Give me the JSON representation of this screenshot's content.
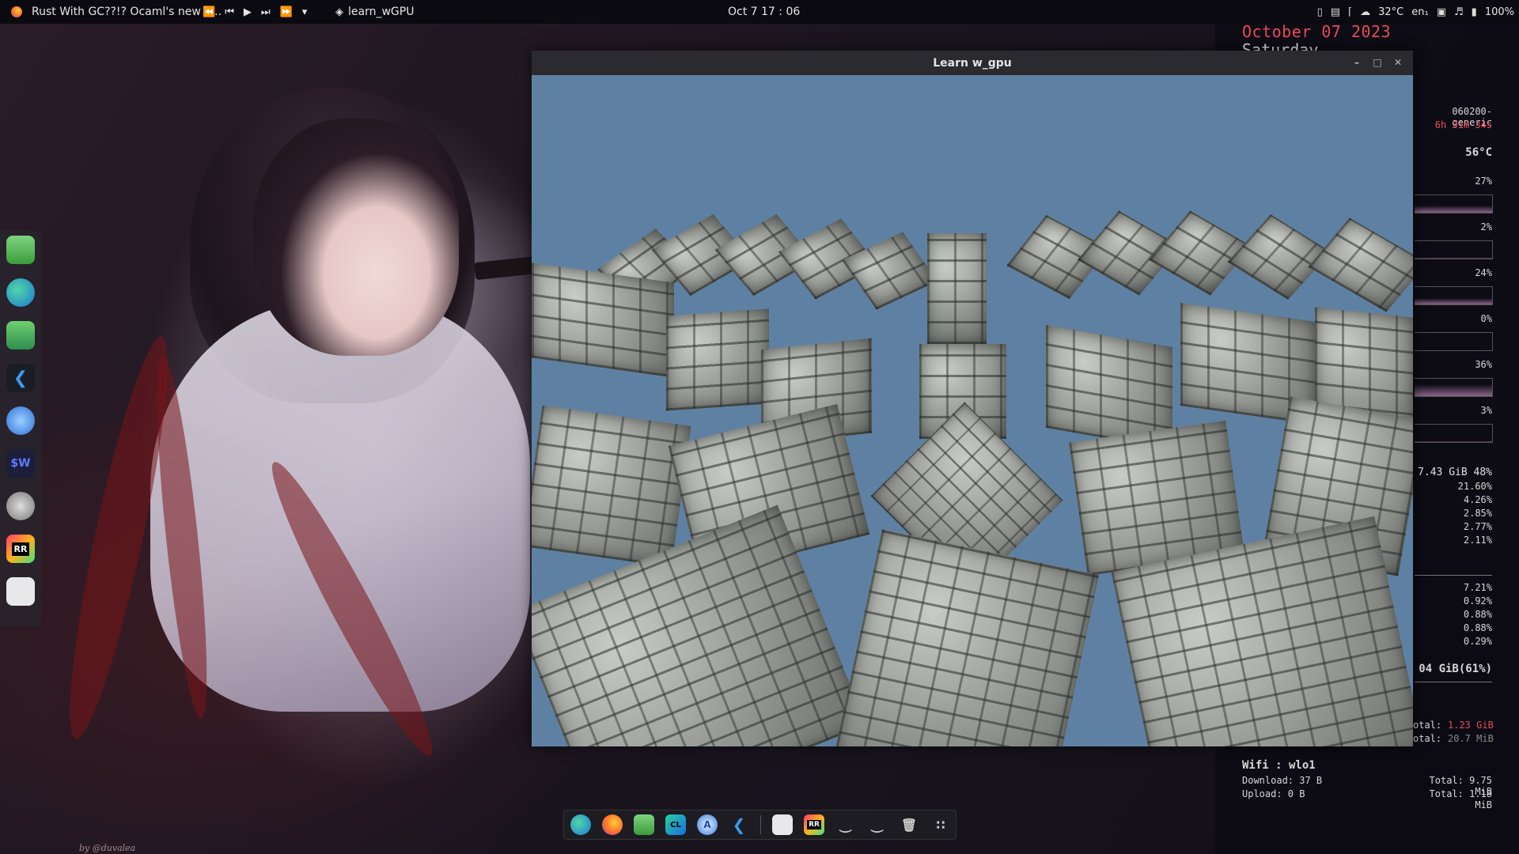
{
  "topbar": {
    "media_title": "Rust With GC??!? Ocaml's new F…",
    "media_controls": [
      "⏪",
      "⏮",
      "▶",
      "⏭",
      "⏩",
      "▾"
    ],
    "active_app": "learn_wGPU",
    "clock": "Oct 7  17 : 06",
    "weather": "32°C",
    "keyboard_layout": "en₁",
    "battery": "100%"
  },
  "window": {
    "title": "Learn w_gpu",
    "minimize": "–",
    "maximize": "□",
    "close": "✕"
  },
  "conky": {
    "date": "October 07 2023",
    "day": "Saturday",
    "kernel": "060200-generic",
    "uptime": "6h 31m 34s",
    "temp": "56°C",
    "cpu_percents": [
      "27%",
      "2%",
      "24%",
      "0%",
      "36%",
      "3%"
    ],
    "ram": "7.43 GiB 48%",
    "top_mem": [
      "21.60%",
      "4.26%",
      "2.85%",
      "2.77%",
      "2.11%"
    ],
    "top_cpu": [
      "7.21%",
      "0.92%",
      "0.88%",
      "0.88%",
      "0.29%"
    ],
    "disk": "04 GiB(61%)",
    "disk_total_read_label": "otal:",
    "disk_total_read": "1.23 GiB",
    "disk_total_write_label": "otal:",
    "disk_total_write": "20.7 MiB",
    "wifi_title": "Wifi : wlo1",
    "download": "Download:  37 B",
    "upload": "Upload:  0 B",
    "total_down": "Total: 9.75 MiB",
    "total_up": "Total: 1.18 MiB",
    "accent": "#e94b5a"
  },
  "left_dock": {
    "items": [
      {
        "icon": "files-icon",
        "label": ""
      },
      {
        "icon": "edge-icon",
        "label": ""
      },
      {
        "icon": "terminal-icon",
        "label": ""
      },
      {
        "icon": "vscode-icon",
        "label": ""
      },
      {
        "icon": "safari-icon",
        "label": ""
      },
      {
        "icon": "warp-icon",
        "label": "$W"
      },
      {
        "icon": "mouse-icon",
        "label": ""
      },
      {
        "icon": "rustrover-icon",
        "label": "RR"
      },
      {
        "icon": "settings-icon",
        "label": ""
      }
    ]
  },
  "bottom_dock": {
    "rr_label": "RR",
    "cl_label": "CL"
  },
  "wallpaper": {
    "signature": "by @duvalea"
  }
}
